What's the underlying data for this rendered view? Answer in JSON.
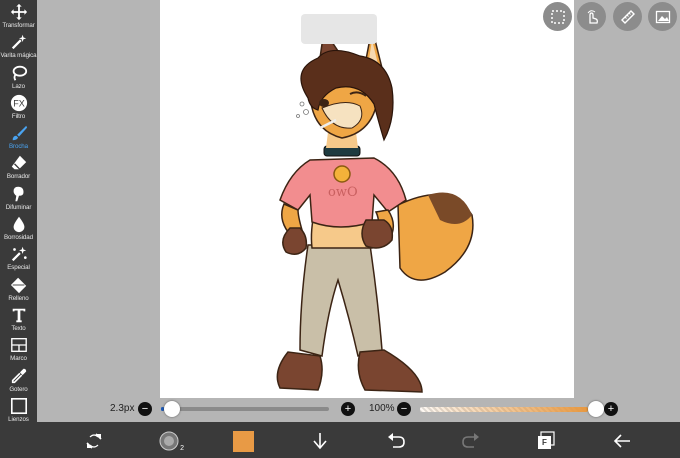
{
  "tools": [
    {
      "label": "Transformar",
      "icon": "move-icon"
    },
    {
      "label": "Varita mágica",
      "icon": "magic-wand-icon"
    },
    {
      "label": "Lazo",
      "icon": "lasso-icon"
    },
    {
      "label": "Filtro",
      "icon": "fx-icon"
    },
    {
      "label": "Brocha",
      "icon": "brush-icon",
      "active": true
    },
    {
      "label": "Borrador",
      "icon": "eraser-icon"
    },
    {
      "label": "Difuminar",
      "icon": "smudge-icon"
    },
    {
      "label": "Borrosidad",
      "icon": "blur-drop-icon"
    },
    {
      "label": "Especial",
      "icon": "sparkle-wand-icon"
    },
    {
      "label": "Relleno",
      "icon": "bucket-icon"
    },
    {
      "label": "Texto",
      "icon": "text-icon"
    },
    {
      "label": "Marco",
      "icon": "frame-icon"
    },
    {
      "label": "Gotero",
      "icon": "eyedropper-icon"
    },
    {
      "label": "Lienzos",
      "icon": "canvas-icon"
    }
  ],
  "brush": {
    "size_label": "2.3px",
    "size_level": 0.02
  },
  "opacity": {
    "label": "100%",
    "level": 1.0,
    "color": "#e89a45"
  },
  "colors": {
    "accent": "#4aa3f0",
    "toolbar": "#3a3a3a",
    "current_color": "#e89a45"
  },
  "top_buttons": [
    "selection-icon",
    "gesture-icon",
    "ruler-icon",
    "gallery-icon"
  ],
  "bottom_buttons": [
    "transform-arrows-icon",
    "brush-preview-icon",
    "color-swatch",
    "download-icon",
    "undo-icon",
    "redo-icon",
    "layers-icon",
    "back-icon"
  ],
  "layers_label": "F",
  "brush_preview_size": "2"
}
